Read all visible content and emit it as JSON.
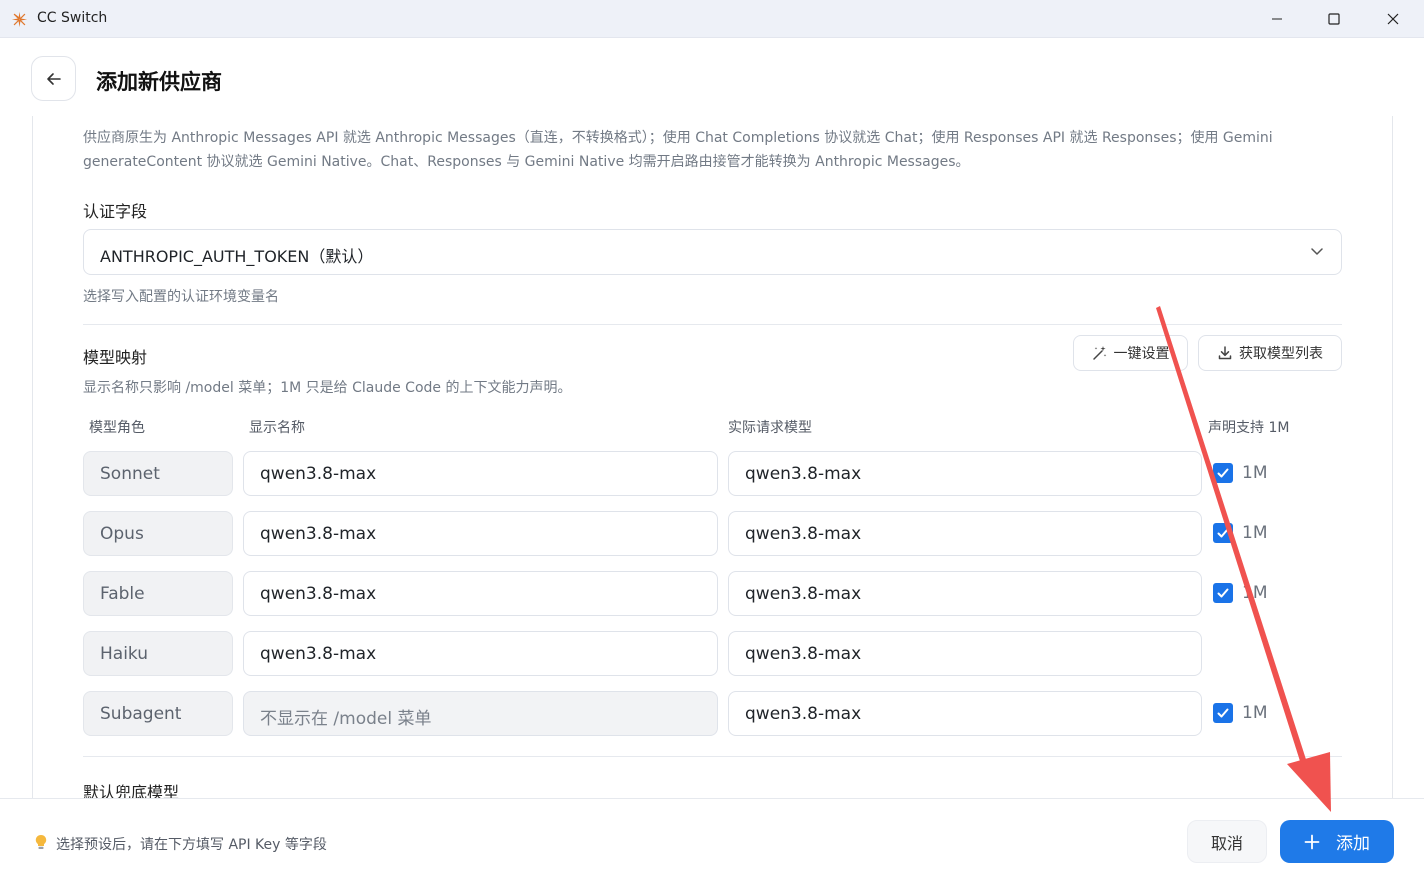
{
  "window": {
    "title": "CC Switch"
  },
  "header": {
    "title": "添加新供应商"
  },
  "api_format_hint": "供应商原生为 Anthropic Messages API 就选 Anthropic Messages（直连，不转换格式）；使用 Chat Completions 协议就选 Chat；使用 Responses API 就选 Responses；使用 Gemini generateContent 协议就选 Gemini Native。Chat、Responses 与 Gemini Native 均需开启路由接管才能转换为 Anthropic Messages。",
  "auth_field": {
    "label": "认证字段",
    "value": "ANTHROPIC_AUTH_TOKEN（默认）",
    "help": "选择写入配置的认证环境变量名"
  },
  "model_mapping": {
    "title": "模型映射",
    "help": "显示名称只影响 /model 菜单；1M 只是给 Claude Code 的上下文能力声明。",
    "one_click_label": "一键设置",
    "fetch_models_label": "获取模型列表",
    "columns": {
      "role": "模型角色",
      "display": "显示名称",
      "actual": "实际请求模型",
      "support": "声明支持 1M"
    },
    "rows": [
      {
        "role": "Sonnet",
        "display": "qwen3.8-max",
        "actual": "qwen3.8-max",
        "has_checkbox": true,
        "checked": true,
        "support_label": "1M"
      },
      {
        "role": "Opus",
        "display": "qwen3.8-max",
        "actual": "qwen3.8-max",
        "has_checkbox": true,
        "checked": true,
        "support_label": "1M"
      },
      {
        "role": "Fable",
        "display": "qwen3.8-max",
        "actual": "qwen3.8-max",
        "has_checkbox": true,
        "checked": true,
        "support_label": "1M"
      },
      {
        "role": "Haiku",
        "display": "qwen3.8-max",
        "actual": "qwen3.8-max",
        "has_checkbox": false,
        "checked": false,
        "support_label": ""
      },
      {
        "role": "Subagent",
        "display": "",
        "display_placeholder": "不显示在 /model 菜单",
        "actual": "qwen3.8-max",
        "has_checkbox": true,
        "checked": true,
        "support_label": "1M"
      }
    ]
  },
  "fallback_model": {
    "label": "默认兜底模型"
  },
  "footer": {
    "hint": "选择预设后，请在下方填写 API Key 等字段",
    "cancel_label": "取消",
    "add_label": "添加"
  },
  "colors": {
    "accent": "#1f7ae8",
    "annotation_arrow": "#f0524f"
  },
  "icons": [
    "app-logo-icon",
    "minimize-icon",
    "maximize-icon",
    "close-icon",
    "arrow-left-icon",
    "chevron-down-icon",
    "magic-wand-icon",
    "download-icon",
    "checkmark-icon",
    "lightbulb-icon",
    "plus-icon"
  ]
}
